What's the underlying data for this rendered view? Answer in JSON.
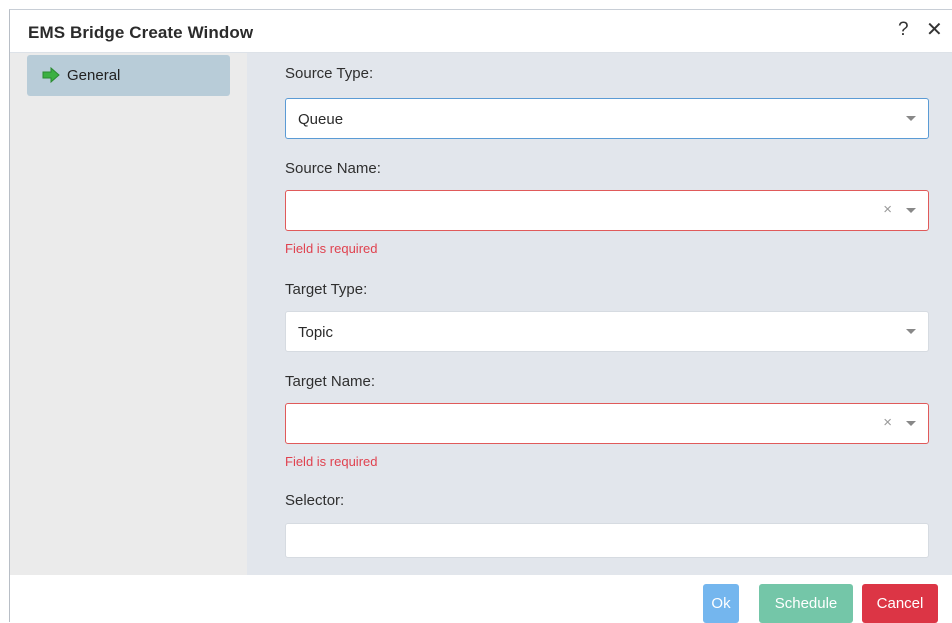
{
  "window": {
    "title": "EMS Bridge Create Window",
    "help_glyph": "?",
    "close_glyph": "✕"
  },
  "sidebar": {
    "items": [
      {
        "label": "General",
        "icon": "arrow-right-icon",
        "selected": true
      }
    ]
  },
  "form": {
    "source_type": {
      "label": "Source Type:",
      "value": "Queue"
    },
    "source_name": {
      "label": "Source Name:",
      "value": "",
      "error": "Field is required",
      "clear_glyph": "×"
    },
    "target_type": {
      "label": "Target Type:",
      "value": "Topic"
    },
    "target_name": {
      "label": "Target Name:",
      "value": "",
      "error": "Field is required",
      "clear_glyph": "×"
    },
    "selector": {
      "label": "Selector:",
      "value": ""
    }
  },
  "footer": {
    "ok_label": "Ok",
    "schedule_label": "Schedule",
    "cancel_label": "Cancel"
  },
  "colors": {
    "nav_selected": "#b8ccd8",
    "content_bg": "#e2e6ec",
    "focus_border": "#5b9bd5",
    "error": "#e0424f",
    "ok": "#74b6ee",
    "schedule": "#74c6a8",
    "cancel": "#dc3545",
    "icon_green": "#3cb043"
  }
}
